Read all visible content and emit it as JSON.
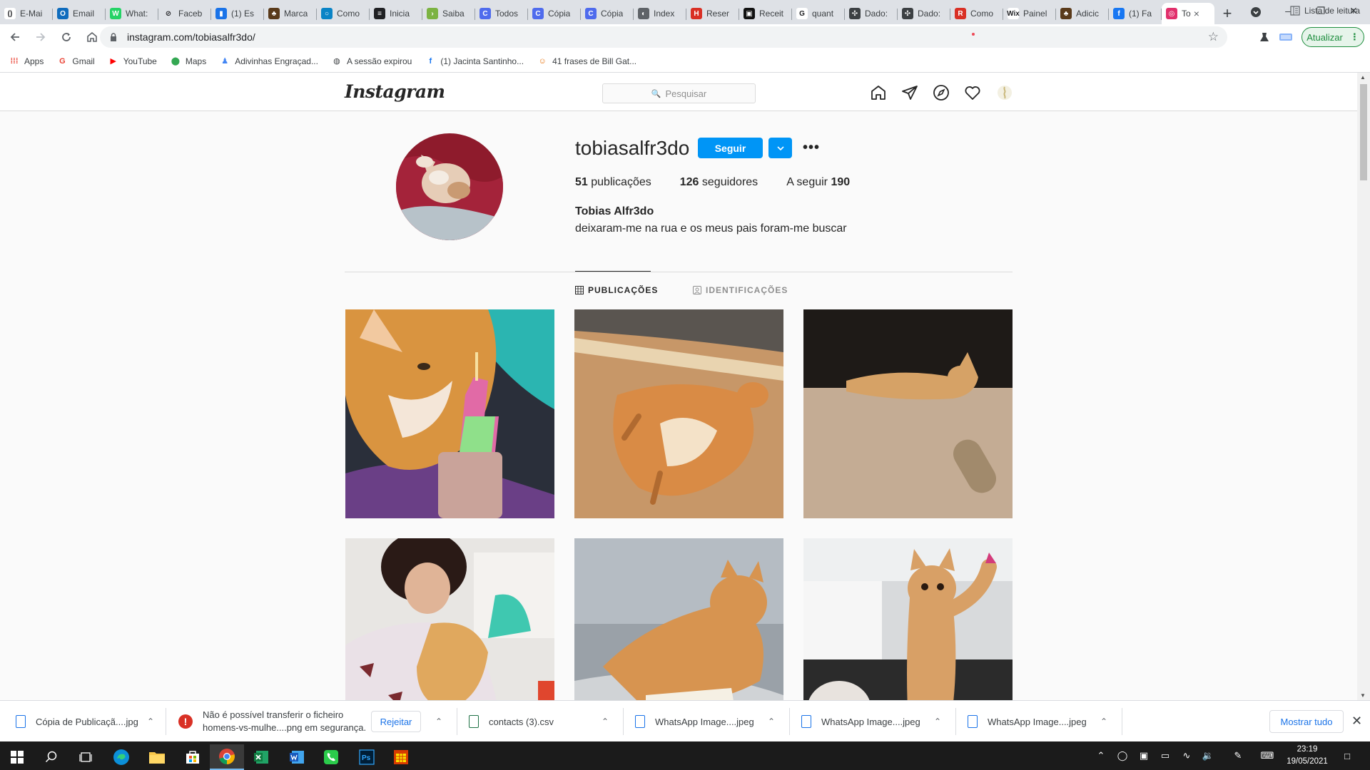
{
  "browser": {
    "tabs": [
      {
        "label": "E-Mai",
        "color": "#ffffff",
        "icon": "brackets-icon",
        "glyph": "()"
      },
      {
        "label": "Email",
        "color": "#0f6cbd",
        "icon": "outlook-icon",
        "glyph": "O"
      },
      {
        "label": "What:",
        "color": "#25d366",
        "icon": "whatsapp-icon",
        "glyph": "W"
      },
      {
        "label": "Faceb",
        "color": "#dee1e6",
        "icon": "circle-arrow-icon",
        "glyph": "⊘"
      },
      {
        "label": "(1) Es",
        "color": "#1a73e8",
        "icon": "bookmark-blue-icon",
        "glyph": "▮"
      },
      {
        "label": "Marca",
        "color": "#5a3a1a",
        "icon": "caricature-icon",
        "glyph": "♣"
      },
      {
        "label": "Como",
        "color": "#0a84c6",
        "icon": "circle-o-icon",
        "glyph": "○"
      },
      {
        "label": "Inicia",
        "color": "#202124",
        "icon": "spotify-icon",
        "glyph": "≡"
      },
      {
        "label": "Saiba",
        "color": "#7cb342",
        "icon": "chevron-green-icon",
        "glyph": "›"
      },
      {
        "label": "Todos",
        "color": "#4f6bed",
        "icon": "c-blue-icon",
        "glyph": "C"
      },
      {
        "label": "Cópia",
        "color": "#4f6bed",
        "icon": "c-blue-icon",
        "glyph": "C"
      },
      {
        "label": "Cópia",
        "color": "#4f6bed",
        "icon": "c-blue-icon",
        "glyph": "C"
      },
      {
        "label": "Index",
        "color": "#5f6368",
        "icon": "globe-icon",
        "glyph": "◐"
      },
      {
        "label": "Reser",
        "color": "#d93025",
        "icon": "reservation-icon",
        "glyph": "H"
      },
      {
        "label": "Receit",
        "color": "#111111",
        "icon": "receipt-icon",
        "glyph": "▣"
      },
      {
        "label": "quant",
        "color": "#ffffff",
        "icon": "google-icon",
        "glyph": "G"
      },
      {
        "label": "Dado:",
        "color": "#3c4043",
        "icon": "users-icon",
        "glyph": "✣"
      },
      {
        "label": "Dado:",
        "color": "#3c4043",
        "icon": "users-icon",
        "glyph": "✣"
      },
      {
        "label": "Como",
        "color": "#d93025",
        "icon": "r-red-icon",
        "glyph": "R"
      },
      {
        "label": "Painel",
        "color": "#ffffff",
        "icon": "wix-icon",
        "glyph": "Wix"
      },
      {
        "label": "Adicic",
        "color": "#5a3a1a",
        "icon": "caricature-icon",
        "glyph": "♣"
      },
      {
        "label": "(1) Fa",
        "color": "#1877f2",
        "icon": "facebook-icon",
        "glyph": "f"
      },
      {
        "label": "To",
        "color": "#e1306c",
        "icon": "instagram-icon",
        "glyph": "◎"
      }
    ],
    "url": "instagram.com/tobiasalfr3do/",
    "update_label": "Atualizar",
    "bookmarks": [
      {
        "label": "Apps",
        "icon": "apps-grid-icon",
        "color": "#ea4335",
        "glyph": "⁞⁞⁞"
      },
      {
        "label": "Gmail",
        "icon": "google-icon",
        "color": "#ea4335",
        "glyph": "G"
      },
      {
        "label": "YouTube",
        "icon": "youtube-icon",
        "color": "#ff0000",
        "glyph": "▶"
      },
      {
        "label": "Maps",
        "icon": "maps-pin-icon",
        "color": "#34a853",
        "glyph": "⬤"
      },
      {
        "label": "Adivinhas Engraçad...",
        "icon": "person-icon",
        "color": "#4285f4",
        "glyph": "♟"
      },
      {
        "label": "A sessão expirou",
        "icon": "globe-icon",
        "color": "#3c4043",
        "glyph": "◍"
      },
      {
        "label": "(1) Jacinta Santinho...",
        "icon": "facebook-icon",
        "color": "#1877f2",
        "glyph": "f"
      },
      {
        "label": "41 frases de Bill Gat...",
        "icon": "smile-icon",
        "color": "#e8710a",
        "glyph": "☺"
      }
    ],
    "reading_list_label": "Lista de leitura"
  },
  "instagram": {
    "logo": "Instagram",
    "search_placeholder": "Pesquisar",
    "profile": {
      "username": "tobiasalfr3do",
      "follow_label": "Seguir",
      "posts_count": "51",
      "posts_label": "publicações",
      "followers_count": "126",
      "followers_label": "seguidores",
      "following_label": "A seguir",
      "following_count": "190",
      "full_name": "Tobias Alfr3do",
      "bio": "deixaram-me na rua e os meus pais foram-me buscar"
    },
    "tabs": {
      "posts": "PUBLICAÇÕES",
      "tagged": "IDENTIFICAÇÕES"
    },
    "accent_color": "#0095f6"
  },
  "downloads": {
    "items": [
      {
        "name": "Cópia de Publicaçã....jpg"
      },
      {
        "warning_line1": "Não é possível transferir o ficheiro",
        "warning_line2": "homens-vs-mulhe....png em segurança.",
        "reject_label": "Rejeitar"
      },
      {
        "name": "contacts (3).csv"
      },
      {
        "name": "WhatsApp Image....jpeg"
      },
      {
        "name": "WhatsApp Image....jpeg"
      },
      {
        "name": "WhatsApp Image....jpeg"
      }
    ],
    "show_all_label": "Mostrar tudo"
  },
  "taskbar": {
    "time": "23:19",
    "date": "19/05/2021"
  }
}
